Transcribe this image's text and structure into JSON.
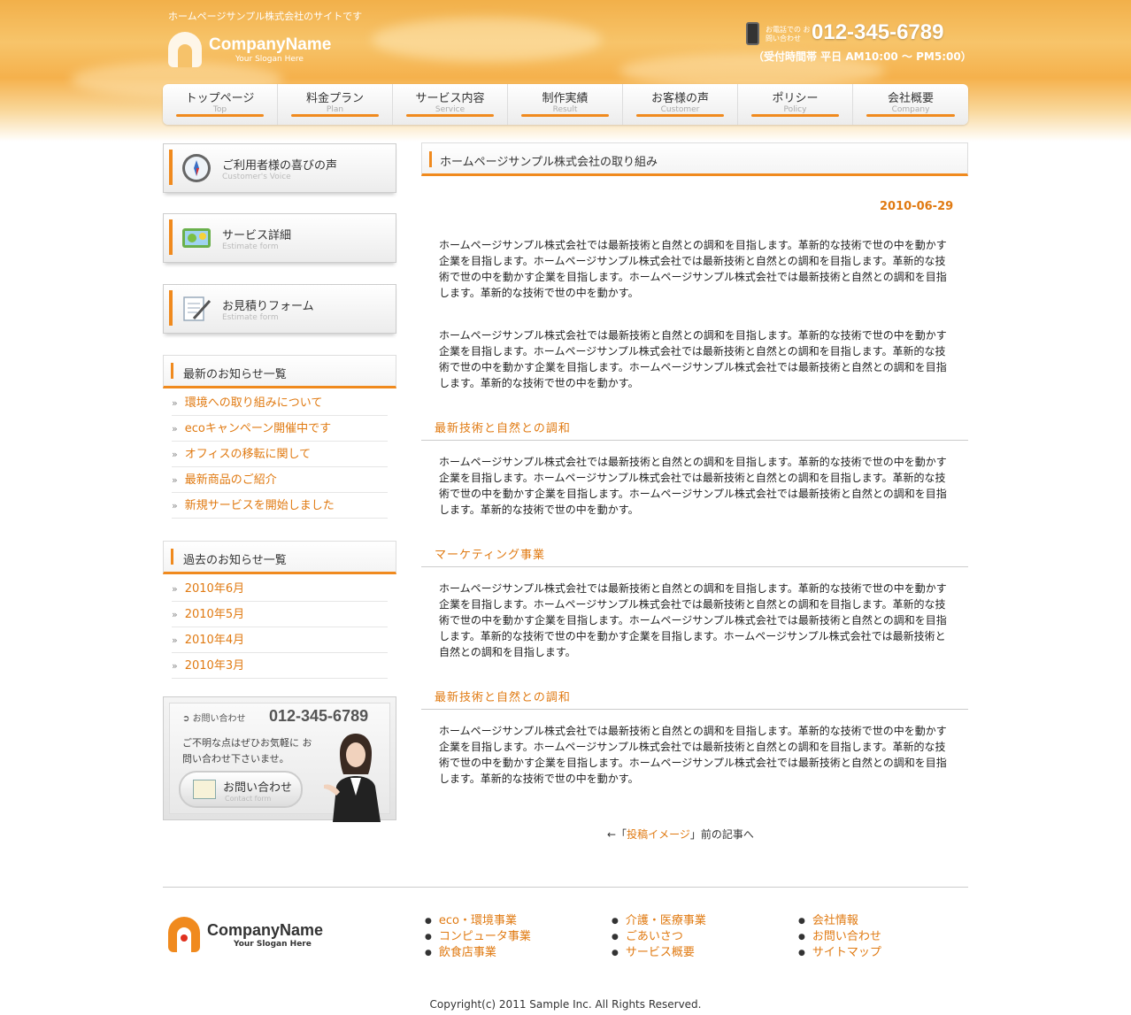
{
  "header": {
    "tagline": "ホームページサンプル株式会社のサイトです",
    "company_name": "CompanyName",
    "slogan": "Your Slogan Here",
    "phone_label": "お電話での お問い合わせ",
    "phone_number": "012-345-6789",
    "phone_hours": "（受付時間帯 平日 AM10:00 ～ PM5:00）"
  },
  "nav": [
    {
      "jp": "トップページ",
      "en": "Top"
    },
    {
      "jp": "料金プラン",
      "en": "Plan"
    },
    {
      "jp": "サービス内容",
      "en": "Service"
    },
    {
      "jp": "制作実績",
      "en": "Result"
    },
    {
      "jp": "お客様の声",
      "en": "Customer"
    },
    {
      "jp": "ポリシー",
      "en": "Policy"
    },
    {
      "jp": "会社概要",
      "en": "Company"
    }
  ],
  "sidebar": {
    "buttons": [
      {
        "title": "ご利用者様の喜びの声",
        "sub": "Customer's Voice",
        "icon": "compass-icon"
      },
      {
        "title": "サービス詳細",
        "sub": "Estimate form",
        "icon": "map-icon"
      },
      {
        "title": "お見積りフォーム",
        "sub": "Estimate form",
        "icon": "form-pen-icon"
      }
    ],
    "latest_title": "最新のお知らせ一覧",
    "latest": [
      "環境への取り組みについて",
      "ecoキャンペーン開催中です",
      "オフィスの移転に関して",
      "最新商品のご紹介",
      "新規サービスを開始しました"
    ],
    "archive_title": "過去のお知らせ一覧",
    "archive": [
      "2010年6月",
      "2010年5月",
      "2010年4月",
      "2010年3月"
    ],
    "contact": {
      "label": "お問い合わせ",
      "number": "012-345-6789",
      "text": "ご不明な点はぜひお気軽に お問い合わせ下さいませ。",
      "button": "お問い合わせ",
      "button_sub": "Contact form"
    }
  },
  "main": {
    "title": "ホームページサンプル株式会社の取り組み",
    "date": "2010-06-29",
    "para1": "ホームページサンプル株式会社では最新技術と自然との調和を目指します。革新的な技術で世の中を動かす企業を目指します。ホームページサンプル株式会社では最新技術と自然との調和を目指します。革新的な技術で世の中を動かす企業を目指します。ホームページサンプル株式会社では最新技術と自然との調和を目指します。革新的な技術で世の中を動かす。",
    "para2": "ホームページサンプル株式会社では最新技術と自然との調和を目指します。革新的な技術で世の中を動かす企業を目指します。ホームページサンプル株式会社では最新技術と自然との調和を目指します。革新的な技術で世の中を動かす企業を目指します。ホームページサンプル株式会社では最新技術と自然との調和を目指します。革新的な技術で世の中を動かす。",
    "sub1": "最新技術と自然との調和",
    "para3": "ホームページサンプル株式会社では最新技術と自然との調和を目指します。革新的な技術で世の中を動かす企業を目指します。ホームページサンプル株式会社では最新技術と自然との調和を目指します。革新的な技術で世の中を動かす企業を目指します。ホームページサンプル株式会社では最新技術と自然との調和を目指します。革新的な技術で世の中を動かす。",
    "sub2": "マーケティング事業",
    "para4": "ホームページサンプル株式会社では最新技術と自然との調和を目指します。革新的な技術で世の中を動かす企業を目指します。ホームページサンプル株式会社では最新技術と自然との調和を目指します。革新的な技術で世の中を動かす企業を目指します。ホームページサンプル株式会社では最新技術と自然との調和を目指します。革新的な技術で世の中を動かす企業を目指します。ホームページサンプル株式会社では最新技術と自然との調和を目指します。",
    "sub3": "最新技術と自然との調和",
    "para5": "ホームページサンプル株式会社では最新技術と自然との調和を目指します。革新的な技術で世の中を動かす企業を目指します。ホームページサンプル株式会社では最新技術と自然との調和を目指します。革新的な技術で世の中を動かす企業を目指します。ホームページサンプル株式会社では最新技術と自然との調和を目指します。革新的な技術で世の中を動かす。",
    "prev_prefix": "←「",
    "prev_link": "投稿イメージ",
    "prev_suffix": "」前の記事へ"
  },
  "footer": {
    "company_name": "CompanyName",
    "slogan": "Your Slogan Here",
    "col1": [
      "eco・環境事業",
      "コンピュータ事業",
      "飲食店事業"
    ],
    "col2": [
      "介護・医療事業",
      "ごあいさつ",
      "サービス概要"
    ],
    "col3": [
      "会社情報",
      "お問い合わせ",
      "サイトマップ"
    ],
    "copyright": "Copyright(c) 2011 Sample Inc. All Rights Reserved."
  },
  "colors": {
    "accent": "#f08a1e",
    "link": "#e07a12"
  }
}
